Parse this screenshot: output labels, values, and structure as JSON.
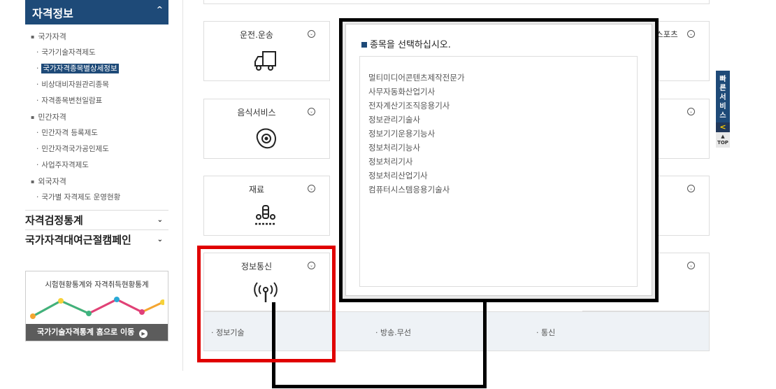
{
  "sidebar": {
    "header": "자격정보",
    "items": [
      {
        "label": "국가자격",
        "level": 1
      },
      {
        "label": "국가기술자격제도",
        "level": 2
      },
      {
        "label": "국가자격종목별상세정보",
        "level": 2,
        "active": true
      },
      {
        "label": "비상대비자원관리종목",
        "level": 2
      },
      {
        "label": "자격종목변천일람표",
        "level": 2
      },
      {
        "label": "민간자격",
        "level": 1
      },
      {
        "label": "민간자격 등록제도",
        "level": 2
      },
      {
        "label": "민간자격국가공인제도",
        "level": 2
      },
      {
        "label": "사업주자격제도",
        "level": 2
      },
      {
        "label": "외국자격",
        "level": 1
      },
      {
        "label": "국가별 자격제도 운영현황",
        "level": 2
      }
    ],
    "sections": [
      "자격검정통계",
      "국가자격대여근절캠페인"
    ],
    "banner": {
      "title": "시험현황통계와 자격취득현황통계",
      "footer": "국가기술자격통계 홈으로 이동"
    }
  },
  "categories": [
    {
      "name": "운전.운송",
      "icon": "truck-icon"
    },
    {
      "name": "음식서비스",
      "icon": "egg-icon"
    },
    {
      "name": "재료",
      "icon": "materials-icon"
    },
    {
      "name": "정보통신",
      "icon": "antenna-icon"
    }
  ],
  "partial_label": "스포츠",
  "subcategories": [
    "· 정보기술",
    "· 방송.무선",
    "· 통신"
  ],
  "popup": {
    "title": "종목을 선택하십시오.",
    "items": [
      "멀티미디어콘텐츠제작전문가",
      "사무자동화산업기사",
      "전자계산기조직응용기사",
      "정보관리기술사",
      "정보기기운용기능사",
      "정보처리기능사",
      "정보처리기사",
      "정보처리산업기사",
      "컴퓨터시스템응용기술사"
    ]
  },
  "quick_service": {
    "label": "빠른서비스",
    "arrow": "<",
    "top": "TOP"
  }
}
